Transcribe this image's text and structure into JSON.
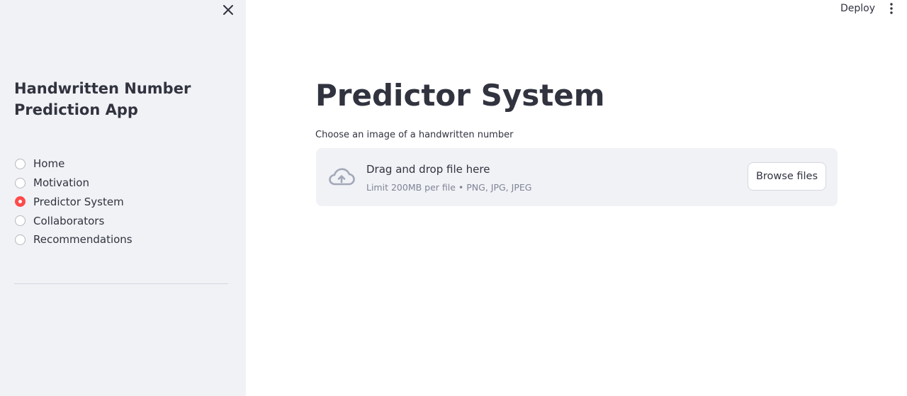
{
  "sidebar": {
    "title": "Handwritten Number Prediction App",
    "close_icon": "close-icon",
    "nav": [
      {
        "label": "Home",
        "selected": false
      },
      {
        "label": "Motivation",
        "selected": false
      },
      {
        "label": "Predictor System",
        "selected": true
      },
      {
        "label": "Collaborators",
        "selected": false
      },
      {
        "label": "Recommendations",
        "selected": false
      }
    ]
  },
  "header": {
    "deploy_label": "Deploy",
    "menu_icon": "vertical-dots-icon"
  },
  "main": {
    "title": "Predictor System",
    "uploader": {
      "label": "Choose an image of a handwritten number",
      "drop_text": "Drag and drop file here",
      "limit_text": "Limit 200MB per file • PNG, JPG, JPEG",
      "browse_label": "Browse files",
      "icon": "cloud-upload-icon"
    }
  },
  "colors": {
    "accent": "#ff4b4b",
    "sidebar_bg": "#f0f2f6",
    "text": "#31333f",
    "muted_text": "#808495",
    "icon": "#a3a8b8"
  }
}
